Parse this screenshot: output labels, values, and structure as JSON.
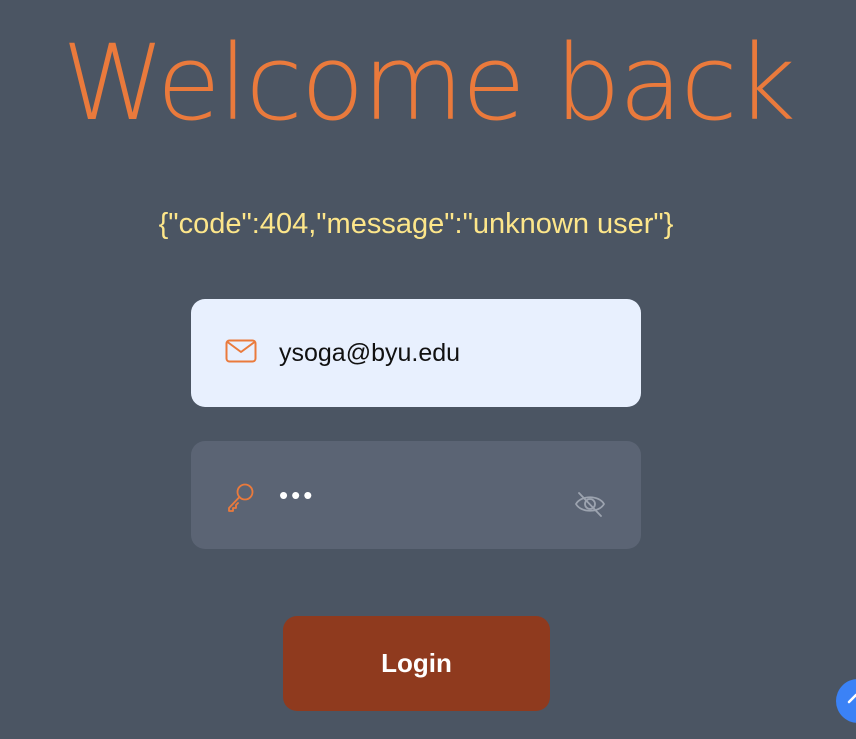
{
  "header": {
    "title": "Welcome back"
  },
  "error": {
    "message": "{\"code\":404,\"message\":\"unknown user\"}"
  },
  "email": {
    "value": "ysoga@byu.edu",
    "icon": "mail-icon"
  },
  "password": {
    "value": "abc",
    "icon": "key-icon",
    "toggle_icon": "eye-off-icon"
  },
  "login": {
    "label": "Login"
  },
  "floating_button": {
    "icon": "chevron-up-icon"
  },
  "colors": {
    "background": "#4b5563",
    "accent": "#ea7a3c",
    "error": "#fde68a",
    "button": "#8f3a1e",
    "email_field": "#e8f0fe",
    "password_field": "#5b6474",
    "fab": "#3b82f6"
  }
}
